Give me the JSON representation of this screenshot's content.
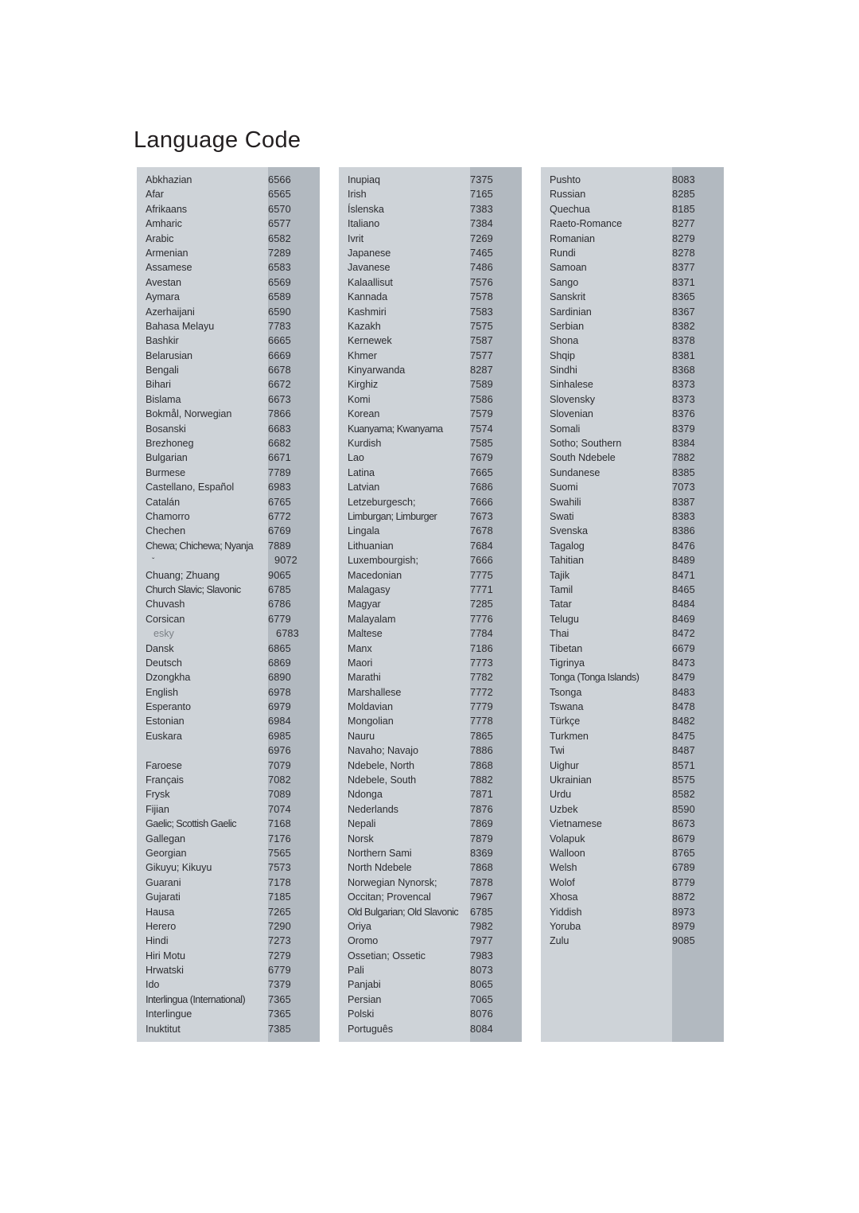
{
  "document": {
    "title": "Language Code"
  },
  "columns": [
    {
      "id": "column-1",
      "rows": [
        {
          "name": "Abkhazian",
          "code": "6566"
        },
        {
          "name": "Afar",
          "code": "6565"
        },
        {
          "name": "Afrikaans",
          "code": "6570"
        },
        {
          "name": "Amharic",
          "code": "6577"
        },
        {
          "name": "Arabic",
          "code": "6582"
        },
        {
          "name": "Armenian",
          "code": "7289"
        },
        {
          "name": "Assamese",
          "code": "6583"
        },
        {
          "name": "Avestan",
          "code": "6569"
        },
        {
          "name": "Aymara",
          "code": "6589"
        },
        {
          "name": "Azerhaijani",
          "code": "6590"
        },
        {
          "name": "Bahasa Melayu",
          "code": "7783"
        },
        {
          "name": "Bashkir",
          "code": "6665"
        },
        {
          "name": "Belarusian",
          "code": "6669"
        },
        {
          "name": "Bengali",
          "code": "6678"
        },
        {
          "name": "Bihari",
          "code": "6672"
        },
        {
          "name": "Bislama",
          "code": "6673"
        },
        {
          "name": "Bokmål, Norwegian",
          "code": "7866"
        },
        {
          "name": "Bosanski",
          "code": "6683"
        },
        {
          "name": "Brezhoneg",
          "code": "6682"
        },
        {
          "name": "Bulgarian",
          "code": "6671"
        },
        {
          "name": "Burmese",
          "code": "7789"
        },
        {
          "name": "Castellano, Español",
          "code": "6983"
        },
        {
          "name": "Catalán",
          "code": "6765"
        },
        {
          "name": "Chamorro",
          "code": "6772"
        },
        {
          "name": "Chechen",
          "code": "6769"
        },
        {
          "name": "Chewa; Chichewa; Nyanja",
          "code": "7889",
          "style": "tight"
        },
        {
          "name": "ˇ",
          "code": "9072",
          "style": "caret"
        },
        {
          "name": "Chuang; Zhuang",
          "code": "9065"
        },
        {
          "name": "Church Slavic; Slavonic",
          "code": "6785",
          "style": "tight"
        },
        {
          "name": "Chuvash",
          "code": "6786"
        },
        {
          "name": "Corsican",
          "code": "6779"
        },
        {
          "name": "esky",
          "code": "6783",
          "style": "faint"
        },
        {
          "name": "Dansk",
          "code": "6865"
        },
        {
          "name": "Deutsch",
          "code": "6869"
        },
        {
          "name": "Dzongkha",
          "code": "6890"
        },
        {
          "name": "English",
          "code": "6978"
        },
        {
          "name": "Esperanto",
          "code": "6979"
        },
        {
          "name": "Estonian",
          "code": "6984"
        },
        {
          "name": "Euskara",
          "code": "6985"
        },
        {
          "name": "",
          "code": "6976"
        },
        {
          "name": "Faroese",
          "code": "7079"
        },
        {
          "name": "Français",
          "code": "7082"
        },
        {
          "name": "Frysk",
          "code": "7089"
        },
        {
          "name": "Fijian",
          "code": "7074"
        },
        {
          "name": "Gaelic; Scottish Gaelic",
          "code": "7168",
          "style": "tight"
        },
        {
          "name": "Gallegan",
          "code": "7176"
        },
        {
          "name": "Georgian",
          "code": "7565"
        },
        {
          "name": "Gikuyu; Kikuyu",
          "code": "7573"
        },
        {
          "name": "Guarani",
          "code": "7178"
        },
        {
          "name": "Gujarati",
          "code": "7185"
        },
        {
          "name": "Hausa",
          "code": "7265"
        },
        {
          "name": "Herero",
          "code": "7290"
        },
        {
          "name": "Hindi",
          "code": "7273"
        },
        {
          "name": "Hiri Motu",
          "code": "7279"
        },
        {
          "name": "Hrwatski",
          "code": "6779"
        },
        {
          "name": "Ido",
          "code": "7379"
        },
        {
          "name": "Interlingua (International)",
          "code": "7365",
          "style": "tight"
        },
        {
          "name": "Interlingue",
          "code": "7365"
        },
        {
          "name": "Inuktitut",
          "code": "7385"
        }
      ]
    },
    {
      "id": "column-2",
      "rows": [
        {
          "name": "Inupiaq",
          "code": "7375"
        },
        {
          "name": "Irish",
          "code": "7165"
        },
        {
          "name": "Íslenska",
          "code": "7383"
        },
        {
          "name": "Italiano",
          "code": "7384"
        },
        {
          "name": "Ivrit",
          "code": "7269"
        },
        {
          "name": "Japanese",
          "code": "7465"
        },
        {
          "name": "Javanese",
          "code": "7486"
        },
        {
          "name": "Kalaallisut",
          "code": "7576"
        },
        {
          "name": "Kannada",
          "code": "7578"
        },
        {
          "name": "Kashmiri",
          "code": "7583"
        },
        {
          "name": "Kazakh",
          "code": "7575"
        },
        {
          "name": "Kernewek",
          "code": "7587"
        },
        {
          "name": "Khmer",
          "code": "7577"
        },
        {
          "name": "Kinyarwanda",
          "code": "8287"
        },
        {
          "name": "Kirghiz",
          "code": "7589"
        },
        {
          "name": "Komi",
          "code": "7586"
        },
        {
          "name": "Korean",
          "code": "7579"
        },
        {
          "name": "Kuanyama; Kwanyama",
          "code": "7574",
          "style": "tight"
        },
        {
          "name": "Kurdish",
          "code": "7585"
        },
        {
          "name": "Lao",
          "code": "7679"
        },
        {
          "name": "Latina",
          "code": "7665"
        },
        {
          "name": "Latvian",
          "code": "7686"
        },
        {
          "name": "Letzeburgesch;",
          "code": "7666"
        },
        {
          "name": "Limburgan; Limburger",
          "code": "7673",
          "style": "tight"
        },
        {
          "name": "Lingala",
          "code": "7678"
        },
        {
          "name": "Lithuanian",
          "code": "7684"
        },
        {
          "name": "Luxembourgish;",
          "code": "7666"
        },
        {
          "name": "Macedonian",
          "code": "7775"
        },
        {
          "name": "Malagasy",
          "code": "7771"
        },
        {
          "name": "Magyar",
          "code": "7285"
        },
        {
          "name": "Malayalam",
          "code": "7776"
        },
        {
          "name": "Maltese",
          "code": "7784"
        },
        {
          "name": "Manx",
          "code": "7186"
        },
        {
          "name": "Maori",
          "code": "7773"
        },
        {
          "name": "Marathi",
          "code": "7782"
        },
        {
          "name": "Marshallese",
          "code": "7772"
        },
        {
          "name": "Moldavian",
          "code": "7779"
        },
        {
          "name": "Mongolian",
          "code": "7778"
        },
        {
          "name": "Nauru",
          "code": "7865"
        },
        {
          "name": "Navaho; Navajo",
          "code": "7886"
        },
        {
          "name": "Ndebele, North",
          "code": "7868"
        },
        {
          "name": "Ndebele, South",
          "code": "7882"
        },
        {
          "name": "Ndonga",
          "code": "7871"
        },
        {
          "name": "Nederlands",
          "code": "7876"
        },
        {
          "name": "Nepali",
          "code": "7869"
        },
        {
          "name": "Norsk",
          "code": "7879"
        },
        {
          "name": "Northern Sami",
          "code": "8369"
        },
        {
          "name": "North Ndebele",
          "code": "7868"
        },
        {
          "name": "Norwegian Nynorsk;",
          "code": "7878"
        },
        {
          "name": "Occitan; Provencal",
          "code": "7967"
        },
        {
          "name": "Old Bulgarian; Old Slavonic",
          "code": "6785",
          "style": "tight"
        },
        {
          "name": "Oriya",
          "code": "7982"
        },
        {
          "name": "Oromo",
          "code": "7977"
        },
        {
          "name": "Ossetian; Ossetic",
          "code": "7983"
        },
        {
          "name": "Pali",
          "code": "8073"
        },
        {
          "name": "Panjabi",
          "code": "8065"
        },
        {
          "name": "Persian",
          "code": "7065"
        },
        {
          "name": "Polski",
          "code": "8076"
        },
        {
          "name": "Português",
          "code": "8084"
        }
      ]
    },
    {
      "id": "column-3",
      "rows": [
        {
          "name": "Pushto",
          "code": "8083"
        },
        {
          "name": "Russian",
          "code": "8285"
        },
        {
          "name": "Quechua",
          "code": "8185"
        },
        {
          "name": "Raeto-Romance",
          "code": "8277"
        },
        {
          "name": "Romanian",
          "code": "8279"
        },
        {
          "name": "Rundi",
          "code": "8278"
        },
        {
          "name": "Samoan",
          "code": "8377"
        },
        {
          "name": "Sango",
          "code": "8371"
        },
        {
          "name": "Sanskrit",
          "code": "8365"
        },
        {
          "name": "Sardinian",
          "code": "8367"
        },
        {
          "name": "Serbian",
          "code": "8382"
        },
        {
          "name": "Shona",
          "code": "8378"
        },
        {
          "name": "Shqip",
          "code": "8381"
        },
        {
          "name": "Sindhi",
          "code": "8368"
        },
        {
          "name": "Sinhalese",
          "code": "8373"
        },
        {
          "name": "Slovensky",
          "code": "8373"
        },
        {
          "name": "Slovenian",
          "code": "8376"
        },
        {
          "name": "Somali",
          "code": "8379"
        },
        {
          "name": "Sotho; Southern",
          "code": "8384"
        },
        {
          "name": "South Ndebele",
          "code": "7882"
        },
        {
          "name": "Sundanese",
          "code": "8385"
        },
        {
          "name": "Suomi",
          "code": "7073"
        },
        {
          "name": "Swahili",
          "code": "8387"
        },
        {
          "name": "Swati",
          "code": "8383"
        },
        {
          "name": "Svenska",
          "code": "8386"
        },
        {
          "name": "Tagalog",
          "code": "8476"
        },
        {
          "name": "Tahitian",
          "code": "8489"
        },
        {
          "name": "Tajik",
          "code": "8471"
        },
        {
          "name": "Tamil",
          "code": "8465"
        },
        {
          "name": "Tatar",
          "code": "8484"
        },
        {
          "name": "Telugu",
          "code": "8469"
        },
        {
          "name": "Thai",
          "code": "8472"
        },
        {
          "name": "Tibetan",
          "code": "6679"
        },
        {
          "name": "Tigrinya",
          "code": "8473"
        },
        {
          "name": "Tonga (Tonga Islands)",
          "code": "8479",
          "style": "tight"
        },
        {
          "name": "Tsonga",
          "code": "8483"
        },
        {
          "name": "Tswana",
          "code": "8478"
        },
        {
          "name": "Türkçe",
          "code": "8482"
        },
        {
          "name": "Turkmen",
          "code": "8475"
        },
        {
          "name": "Twi",
          "code": "8487"
        },
        {
          "name": "Uighur",
          "code": "8571"
        },
        {
          "name": "Ukrainian",
          "code": "8575"
        },
        {
          "name": "Urdu",
          "code": "8582"
        },
        {
          "name": "Uzbek",
          "code": "8590"
        },
        {
          "name": "Vietnamese",
          "code": "8673"
        },
        {
          "name": "Volapuk",
          "code": "8679"
        },
        {
          "name": "Walloon",
          "code": "8765"
        },
        {
          "name": "Welsh",
          "code": "6789"
        },
        {
          "name": "Wolof",
          "code": "8779"
        },
        {
          "name": "Xhosa",
          "code": "8872"
        },
        {
          "name": "Yiddish",
          "code": "8973"
        },
        {
          "name": "Yoruba",
          "code": "8979"
        },
        {
          "name": "Zulu",
          "code": "9085"
        }
      ]
    }
  ],
  "colors": {
    "panel_name_bg": "#ced3d8",
    "panel_code_bg": "#b2b9c0",
    "text": "#2b2b2f",
    "page_bg": "#ffffff"
  }
}
